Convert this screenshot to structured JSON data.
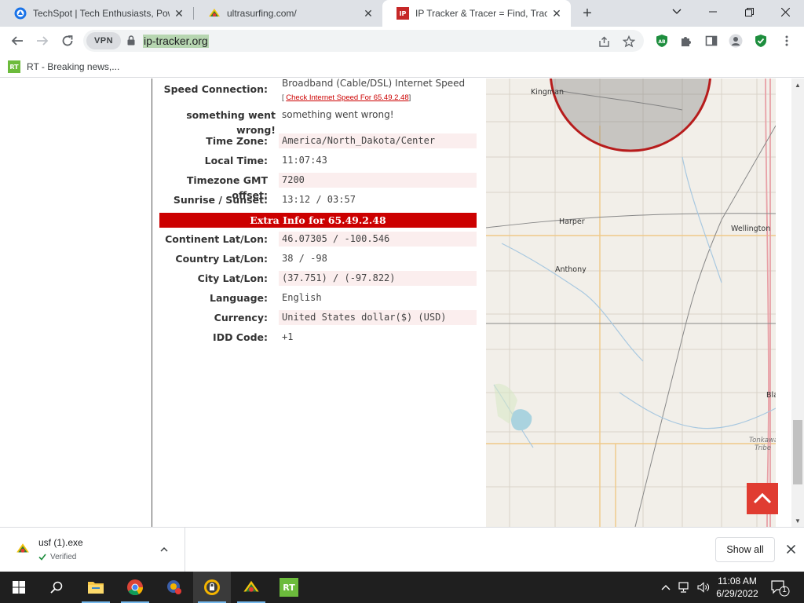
{
  "browser": {
    "tabs": [
      {
        "title": "TechSpot | Tech Enthusiasts, Pow",
        "icon": "techspot-icon",
        "active": false
      },
      {
        "title": "ultrasurfing.com/",
        "icon": "ultrasurf-icon",
        "active": false
      },
      {
        "title": "IP Tracker & Tracer = Find, Track",
        "icon": "ip-tracker-icon",
        "active": true
      }
    ],
    "new_tab": "+",
    "window_controls": {
      "list": "⌄",
      "minimize": "—",
      "restore": "❐",
      "close": "✕"
    },
    "vpn_label": "VPN",
    "url": "ip-tracker.org",
    "bookmarks": [
      {
        "label": "RT - Breaking news,...",
        "icon_text": "RT"
      }
    ]
  },
  "page": {
    "speed": {
      "label": "Speed Connection:",
      "value": "Broadband (Cable/DSL) Internet Speed",
      "link_prefix": "[ ",
      "link_text": "Check Internet Speed For 65.49.2.48",
      "link_suffix": "]"
    },
    "error": {
      "label": "something went wrong!",
      "value": "something went wrong!"
    },
    "rows_top": [
      {
        "label": "Time Zone:",
        "value": "America/North_Dakota/Center",
        "shade": true
      },
      {
        "label": "Local Time:",
        "value": "11:07:43",
        "shade": false
      },
      {
        "label": "Timezone GMT offset:",
        "value": "7200",
        "shade": true
      },
      {
        "label": "Sunrise / Sunset:",
        "value": "13:12 / 03:57",
        "shade": false
      }
    ],
    "extra_title": "Extra Info for 65.49.2.48",
    "rows_bottom": [
      {
        "label": "Continent Lat/Lon:",
        "value": "46.07305 / -100.546",
        "shade": true
      },
      {
        "label": "Country Lat/Lon:",
        "value": "38 / -98",
        "shade": false
      },
      {
        "label": "City Lat/Lon:",
        "value": "(37.751) / (-97.822)",
        "shade": true
      },
      {
        "label": "Language:",
        "value": "English",
        "shade": false
      },
      {
        "label": "Currency:",
        "value": "United States dollar($) (USD)",
        "shade": true
      },
      {
        "label": "IDD Code:",
        "value": "+1",
        "shade": false
      }
    ],
    "map": {
      "labels": [
        "Kingman",
        "Harper",
        "Wellington",
        "Anthony",
        "Bla",
        "Tonkawa",
        "Tribe"
      ]
    }
  },
  "downloads": {
    "file_name": "usf (1).exe",
    "status": "Verified",
    "show_all": "Show all"
  },
  "taskbar": {
    "time": "11:08 AM",
    "date": "6/29/2022",
    "notification_count": "1"
  },
  "colors": {
    "accent_red": "#cc0000",
    "url_highlight": "#b7d6b1",
    "row_shade": "#fbeeee"
  }
}
